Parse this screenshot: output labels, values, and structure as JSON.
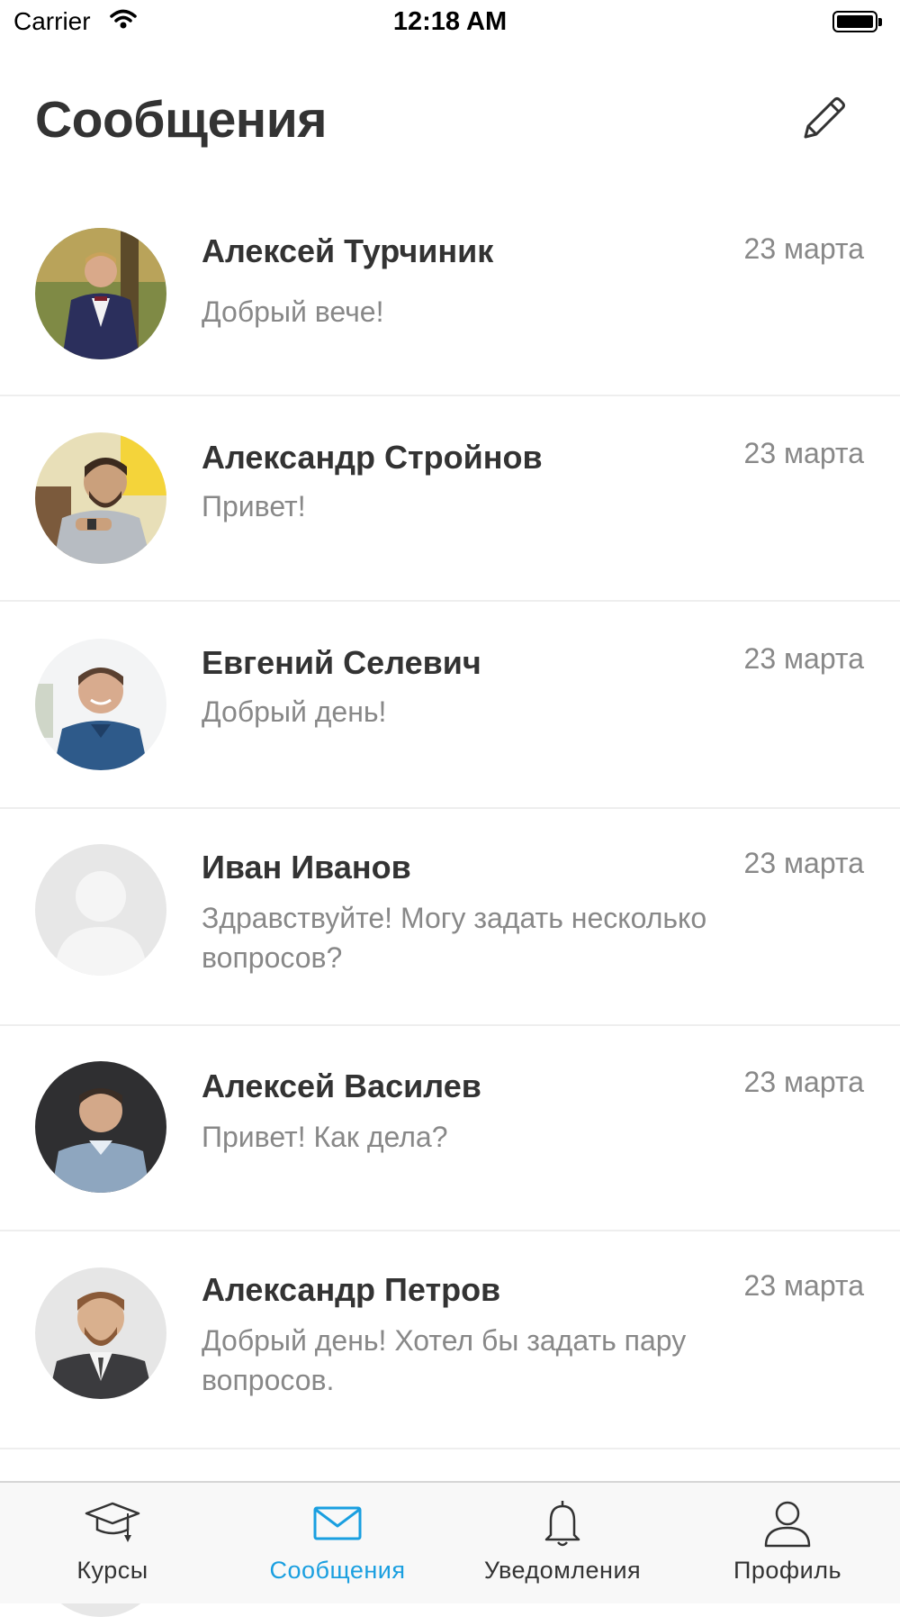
{
  "status_bar": {
    "carrier": "Carrier",
    "time": "12:18 AM"
  },
  "header": {
    "title": "Сообщения"
  },
  "conversations": [
    {
      "name": "Алексей Турчиник",
      "date": "23 марта",
      "preview": "Добрый вече!"
    },
    {
      "name": "Александр Стройнов",
      "date": "23 марта",
      "preview": "Привет!"
    },
    {
      "name": "Евгений Селевич",
      "date": "23 марта",
      "preview": "Добрый день!"
    },
    {
      "name": "Иван Иванов",
      "date": "23 марта",
      "preview": "Здравствуйте! Могу задать несколько вопросов?"
    },
    {
      "name": "Алексей Василев",
      "date": "23 марта",
      "preview": "Привет! Как дела?"
    },
    {
      "name": "Александр Петров",
      "date": "23 марта",
      "preview": "Добрый день! Хотел бы задать пару вопросов."
    }
  ],
  "tabs": [
    {
      "label": "Курсы",
      "icon": "graduation-cap-icon"
    },
    {
      "label": "Сообщения",
      "icon": "envelope-icon",
      "active": true
    },
    {
      "label": "Уведомления",
      "icon": "bell-icon"
    },
    {
      "label": "Профиль",
      "icon": "user-icon"
    }
  ],
  "colors": {
    "accent": "#1a9fe0",
    "text": "#333333",
    "secondary_text": "#888888",
    "separator": "#eeeeee",
    "tabbar_bg": "#f8f8f8"
  }
}
